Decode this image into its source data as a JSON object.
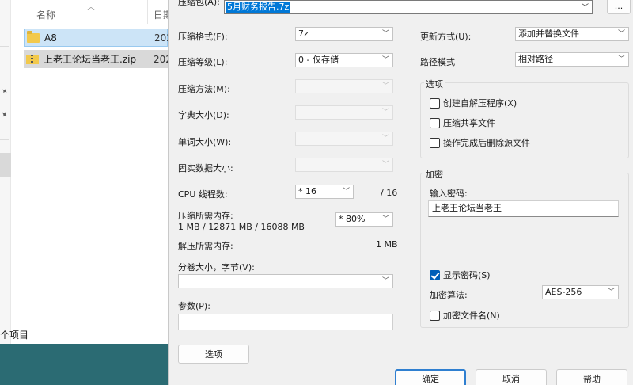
{
  "explorer": {
    "columns": {
      "name": "名称",
      "date": "日期"
    },
    "files": [
      {
        "name": "A8",
        "date": "202",
        "type": "folder"
      },
      {
        "name": "上老王论坛当老王.zip",
        "date": "202",
        "type": "zip"
      }
    ],
    "status": "个项目"
  },
  "dialog": {
    "archive_label": "压缩包(A):",
    "archive_name": "5月财务报告.7z",
    "browse_label": "...",
    "format_label": "压缩格式(F):",
    "format_value": "7z",
    "level_label": "压缩等级(L):",
    "level_value": "0 - 仅存储",
    "method_label": "压缩方法(M):",
    "dict_label": "字典大小(D):",
    "word_label": "单词大小(W):",
    "solid_label": "固实数据大小:",
    "cpu_label": "CPU 线程数:",
    "cpu_value": "* 16",
    "cpu_total": "/ 16",
    "mem_compress_label": "压缩所需内存:",
    "mem_compress_value": "1 MB / 12871 MB / 16088 MB",
    "mem_percent": "* 80%",
    "mem_decompress_label": "解压所需内存:",
    "mem_decompress_value": "1 MB",
    "split_label": "分卷大小，字节(V):",
    "split_value": "",
    "params_label": "参数(P):",
    "params_value": "",
    "options_button": "选项",
    "update_label": "更新方式(U):",
    "update_value": "添加并替换文件",
    "path_label": "路径模式",
    "path_value": "相对路径",
    "options_group": {
      "title": "选项",
      "sfx": {
        "label": "创建自解压程序(X)",
        "checked": false
      },
      "shared": {
        "label": "压缩共享文件",
        "checked": false
      },
      "delete_after": {
        "label": "操作完成后删除源文件",
        "checked": false
      }
    },
    "encryption_group": {
      "title": "加密",
      "password_label": "输入密码:",
      "password_value": "上老王论坛当老王",
      "show_password": {
        "label": "显示密码(S)",
        "checked": true
      },
      "method_label": "加密算法:",
      "method_value": "AES-256",
      "encrypt_names": {
        "label": "加密文件名(N)",
        "checked": false
      }
    },
    "buttons": {
      "ok": "确定",
      "cancel": "取消",
      "help": "帮助"
    }
  }
}
